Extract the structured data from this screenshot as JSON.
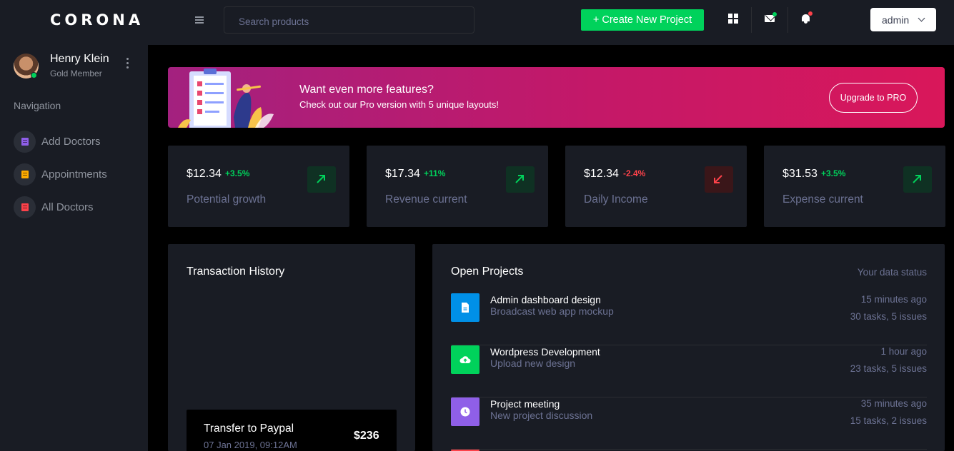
{
  "brand": "CORONA",
  "profile": {
    "name": "Henry Klein",
    "role": "Gold Member"
  },
  "nav": {
    "heading": "Navigation",
    "items": [
      {
        "label": "Add Doctors",
        "icon": "document-icon",
        "color": "#8f5fe8"
      },
      {
        "label": "Appointments",
        "icon": "document-icon",
        "color": "#ffab00"
      },
      {
        "label": "All Doctors",
        "icon": "document-icon",
        "color": "#fc424a"
      }
    ]
  },
  "topbar": {
    "search_placeholder": "Search products",
    "create_button": "+ Create New Project",
    "user_menu": "admin"
  },
  "banner": {
    "title": "Want even more features?",
    "subtitle": "Check out our Pro version with 5 unique layouts!",
    "button": "Upgrade to PRO"
  },
  "stats": [
    {
      "value": "$12.34",
      "change": "+3.5%",
      "trend": "up",
      "label": "Potential growth"
    },
    {
      "value": "$17.34",
      "change": "+11%",
      "trend": "up",
      "label": "Revenue current"
    },
    {
      "value": "$12.34",
      "change": "-2.4%",
      "trend": "down",
      "label": "Daily Income"
    },
    {
      "value": "$31.53",
      "change": "+3.5%",
      "trend": "up",
      "label": "Expense current"
    }
  ],
  "transactions": {
    "title": "Transaction History",
    "items": [
      {
        "label": "Transfer to Paypal",
        "date": "07 Jan 2019, 09:12AM",
        "amount": "$236"
      }
    ]
  },
  "projects": {
    "title": "Open Projects",
    "note": "Your data status",
    "items": [
      {
        "title": "Admin dashboard design",
        "subtitle": "Broadcast web app mockup",
        "time": "15 minutes ago",
        "tasks": "30 tasks, 5 issues",
        "icon": "file-icon",
        "color": "#0090e7"
      },
      {
        "title": "Wordpress Development",
        "subtitle": "Upload new design",
        "time": "1 hour ago",
        "tasks": "23 tasks, 5 issues",
        "icon": "cloud-upload-icon",
        "color": "#00d25b"
      },
      {
        "title": "Project meeting",
        "subtitle": "New project discussion",
        "time": "35 minutes ago",
        "tasks": "15 tasks, 2 issues",
        "icon": "clock-icon",
        "color": "#8f5fe8"
      }
    ]
  },
  "colors": {
    "success": "#00d25b",
    "danger": "#fc424a",
    "muted": "#6c7293",
    "card": "#191c24"
  }
}
